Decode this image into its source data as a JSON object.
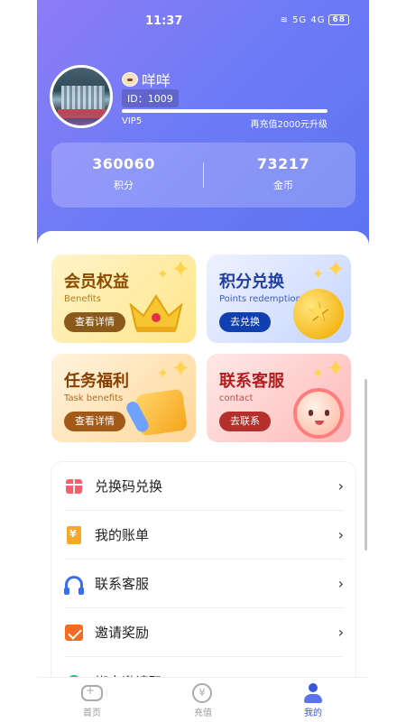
{
  "status_bar": {
    "time": "11:37",
    "network": "5G 4G",
    "battery": "68"
  },
  "profile": {
    "name": "咩咩",
    "id_label": "ID：1009",
    "vip_level": "VIP5",
    "vip_progress": 1.0,
    "upgrade_hint": "再充值2000元升级"
  },
  "stats": [
    {
      "value": "360060",
      "label": "积分"
    },
    {
      "value": "73217",
      "label": "金币"
    }
  ],
  "cards": [
    {
      "title": "会员权益",
      "subtitle": "Benefits",
      "button": "查看详情",
      "icon": "crown-icon"
    },
    {
      "title": "积分兑换",
      "subtitle": "Points redemption",
      "button": "去兑换",
      "icon": "coin-icon"
    },
    {
      "title": "任务福利",
      "subtitle": "Task benefits",
      "button": "查看详情",
      "icon": "notebook-icon"
    },
    {
      "title": "联系客服",
      "subtitle": "contact",
      "button": "去联系",
      "icon": "support-face-icon"
    }
  ],
  "menu": [
    {
      "label": "兑换码兑换",
      "icon": "gift-icon"
    },
    {
      "label": "我的账单",
      "icon": "bill-icon"
    },
    {
      "label": "联系客服",
      "icon": "headset-icon"
    },
    {
      "label": "邀请奖励",
      "icon": "invite-icon"
    },
    {
      "label": "绑定邀请码",
      "icon": "bind-icon"
    }
  ],
  "tabbar": [
    {
      "label": "首页",
      "icon": "gamepad-icon",
      "active": false
    },
    {
      "label": "充值",
      "icon": "recharge-icon",
      "active": false
    },
    {
      "label": "我的",
      "icon": "profile-icon",
      "active": true
    }
  ],
  "colors": {
    "header_gradient_start": "#8d7cf6",
    "header_gradient_end": "#5a73f0",
    "active_tab": "#3a55e0"
  }
}
